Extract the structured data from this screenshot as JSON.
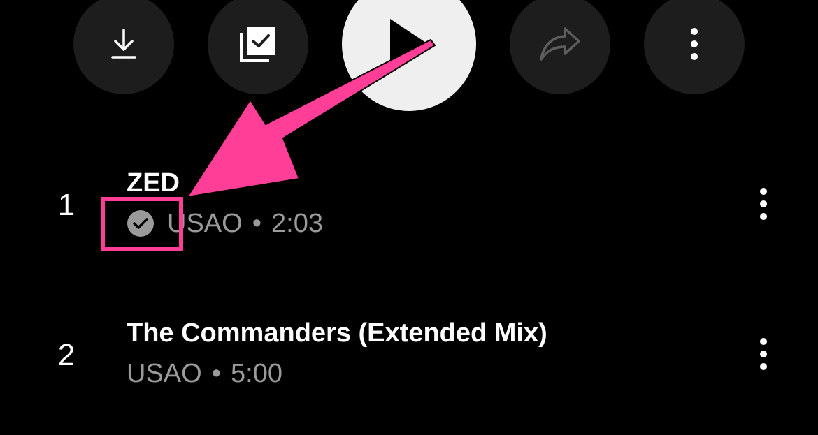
{
  "colors": {
    "background": "#000000",
    "action_button_bg": "#1d1d1d",
    "play_button_bg": "#efefef",
    "title_text": "#ffffff",
    "meta_text": "#9a9a9a",
    "annotation": "#ff3e98"
  },
  "actions": [
    {
      "name": "download-button",
      "icon": "download-icon"
    },
    {
      "name": "save-to-library-button",
      "icon": "library-check-icon"
    },
    {
      "name": "play-button",
      "icon": "play-icon"
    },
    {
      "name": "share-button",
      "icon": "share-icon"
    },
    {
      "name": "more-options-button",
      "icon": "more-vertical-icon"
    }
  ],
  "tracks": [
    {
      "number": "1",
      "title": "ZED",
      "artist": "USAO",
      "separator": "•",
      "duration": "2:03",
      "downloaded": true,
      "icon": "downloaded-check-icon"
    },
    {
      "number": "2",
      "title": "The Commanders (Extended Mix)",
      "artist": "USAO",
      "separator": "•",
      "duration": "5:00",
      "downloaded": false
    }
  ],
  "annotation": {
    "type": "arrow-and-box",
    "target": "downloaded-check-icon"
  }
}
